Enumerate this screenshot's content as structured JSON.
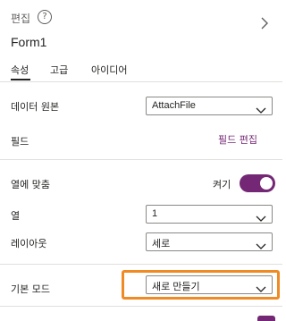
{
  "header": {
    "title": "편집",
    "help_icon": "?",
    "form_name": "Form1",
    "tabs": [
      {
        "label": "속성",
        "active": true
      },
      {
        "label": "고급",
        "active": false
      },
      {
        "label": "아이디어",
        "active": false
      }
    ]
  },
  "properties": {
    "data_source": {
      "label": "데이터 원본",
      "value": "AttachFile"
    },
    "fields": {
      "label": "필드",
      "link": "필드 편집"
    },
    "snap_to_columns": {
      "label": "열에 맞춤",
      "state_label": "켜기"
    },
    "columns": {
      "label": "열",
      "value": "1"
    },
    "layout": {
      "label": "레이아웃",
      "value": "세로"
    },
    "default_mode": {
      "label": "기본 모드",
      "value": "새로 만들기"
    }
  },
  "colors": {
    "accent": "#742774",
    "highlight": "#f08a24",
    "divider": "#e1dfdd"
  }
}
